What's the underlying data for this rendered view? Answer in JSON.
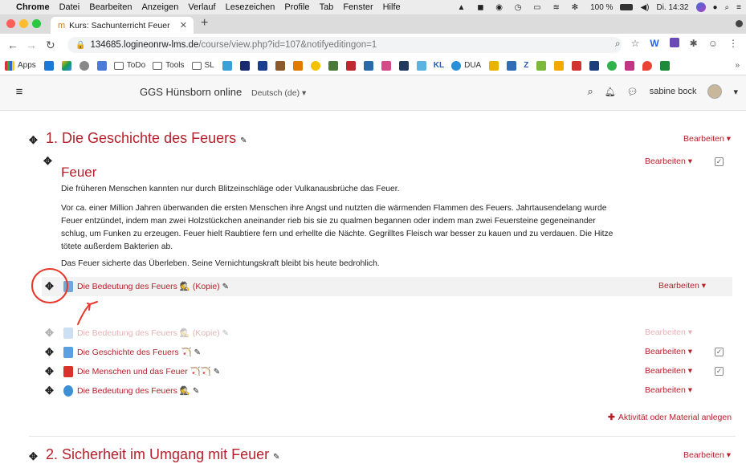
{
  "menubar": {
    "app": "Chrome",
    "items": [
      "Datei",
      "Bearbeiten",
      "Anzeigen",
      "Verlauf",
      "Lesezeichen",
      "Profile",
      "Tab",
      "Fenster",
      "Hilfe"
    ],
    "battery": "100 %",
    "clock": "Di. 14:32"
  },
  "tab": {
    "title": "Kurs: Sachunterricht Feuer"
  },
  "address": {
    "host": "134685.logineonrw-lms.de",
    "path": "/course/view.php?id=107&notifyeditingon=1"
  },
  "bookmarks": {
    "apps": "Apps",
    "todo": "ToDo",
    "tools": "Tools",
    "sl": "SL",
    "kl": "KL",
    "dua": "DUA",
    "z": "Z"
  },
  "navbar": {
    "site_name": "GGS Hünsborn online",
    "language": "Deutsch (de) ▾",
    "user": "sabine bock"
  },
  "section1": {
    "title": "1. Die Geschichte des Feuers",
    "edit": "Bearbeiten ▾"
  },
  "label_block": {
    "heading": "Feuer",
    "edit": "Bearbeiten ▾",
    "p1": "Die früheren Menschen kannten nur durch Blitzeinschläge oder Vulkanausbrüche das Feuer.",
    "p2_l1": "Vor ca. einer Million Jahren überwanden die ersten Menschen ihre Angst und nutzten die wärmenden Flammen des Feuers. Jahrtausendelang wurde",
    "p2_l2": "Feuer entzündet, indem man zwei Holzstückchen aneinander rieb bis sie zu qualmen begannen oder indem man zwei Feuersteine gegeneinander",
    "p2_l3": "schlug, um Funken zu erzeugen. Feuer hielt Raubtiere fern und erhellte die Nächte. Gegrilltes Fleisch war besser zu kauen und zu verdauen. Die Hitze",
    "p2_l4": "tötete außerdem Bakterien ab.",
    "p3": "Das Feuer sicherte das Überleben. Seine Vernichtungskraft bleibt bis heute bedrohlich."
  },
  "activities": [
    {
      "name": "Die Bedeutung des Feuers 🕵 (Kopie)",
      "edit": "Bearbeiten ▾",
      "icon_color": "#6fa7d8"
    },
    {
      "name": "Die Bedeutung des Feuers 🕵 (Kopie)",
      "edit": "Bearbeiten ▾",
      "icon_color": "#cfe0ef"
    },
    {
      "name": "Die Geschichte des Feuers 🏹",
      "edit": "Bearbeiten ▾",
      "icon_color": "#5aa0e0"
    },
    {
      "name": "Die Menschen und das Feuer 🏹🏹",
      "edit": "Bearbeiten ▾",
      "icon_color": "#d9322b"
    },
    {
      "name": "Die Bedeutung des Feuers 🕵",
      "edit": "Bearbeiten ▾",
      "icon_color": "#3d8fd6"
    }
  ],
  "add_activity": "Aktivität oder Material anlegen",
  "section2": {
    "title": "2. Sicherheit im Umgang mit Feuer",
    "edit": "Bearbeiten ▾"
  },
  "colors": {
    "accent": "#b5202a",
    "annotation": "#e8382b"
  }
}
